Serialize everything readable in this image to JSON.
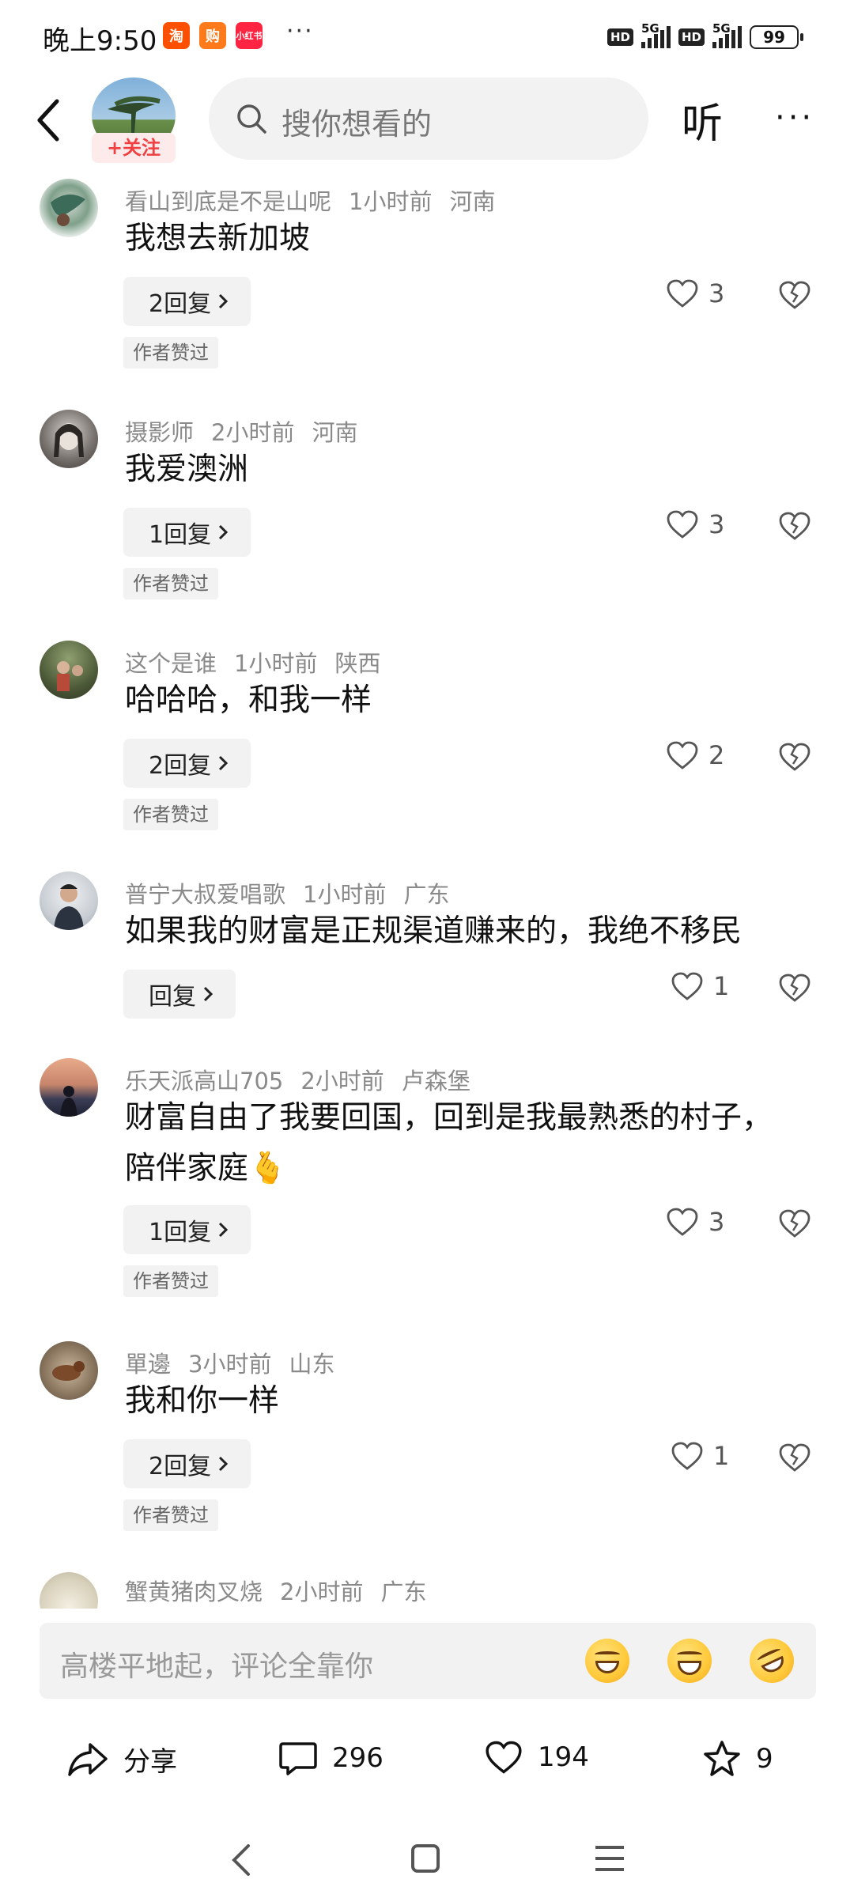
{
  "status_bar": {
    "time": "晚上9:50",
    "app_icons": [
      "淘",
      "购",
      "小红书"
    ],
    "more": "···",
    "hd1": "HD",
    "net1": "5G",
    "hd2": "HD",
    "net2": "5G",
    "battery": "99"
  },
  "header": {
    "follow_label": "+关注",
    "search_placeholder": "搜你想看的",
    "listen_label": "听",
    "more_label": "···"
  },
  "comments": [
    {
      "user": "看山到底是不是山呢",
      "time": "1小时前",
      "location": "河南",
      "text": "我想去新加坡",
      "reply_label": "2回复",
      "likes": "3",
      "author_liked": "作者赞过"
    },
    {
      "user": "摄影师",
      "time": "2小时前",
      "location": "河南",
      "text": "我爱澳洲",
      "reply_label": "1回复",
      "likes": "3",
      "author_liked": "作者赞过"
    },
    {
      "user": "这个是谁",
      "time": "1小时前",
      "location": "陕西",
      "text": "哈哈哈，和我一样",
      "reply_label": "2回复",
      "likes": "2",
      "author_liked": "作者赞过"
    },
    {
      "user": "普宁大叔爱唱歌",
      "time": "1小时前",
      "location": "广东",
      "text": "如果我的财富是正规渠道赚来的，我绝不移民",
      "reply_label": "回复",
      "likes": "1",
      "author_liked": ""
    },
    {
      "user": "乐天派高山705",
      "time": "2小时前",
      "location": "卢森堡",
      "text": "财富自由了我要回国，回到是我最熟悉的村子，陪伴家庭",
      "emoji": "🫰",
      "reply_label": "1回复",
      "likes": "3",
      "author_liked": "作者赞过"
    },
    {
      "user": "單邊",
      "time": "3小时前",
      "location": "山东",
      "text": "我和你一样",
      "reply_label": "2回复",
      "likes": "1",
      "author_liked": "作者赞过"
    },
    {
      "user": "蟹黄猪肉叉烧",
      "time": "2小时前",
      "location": "广东"
    }
  ],
  "input_bar": {
    "placeholder": "高楼平地起，评论全靠你",
    "emojis": [
      "grinning-squinting-face",
      "beaming-face",
      "rolling-laughing-face"
    ]
  },
  "actions": {
    "share_label": "分享",
    "comments_count": "296",
    "likes_count": "194",
    "favorites_count": "9"
  },
  "colors": {
    "accent_red": "#f04142",
    "chip_bg": "#f2f2f2",
    "meta_gray": "#8a8a8a"
  }
}
